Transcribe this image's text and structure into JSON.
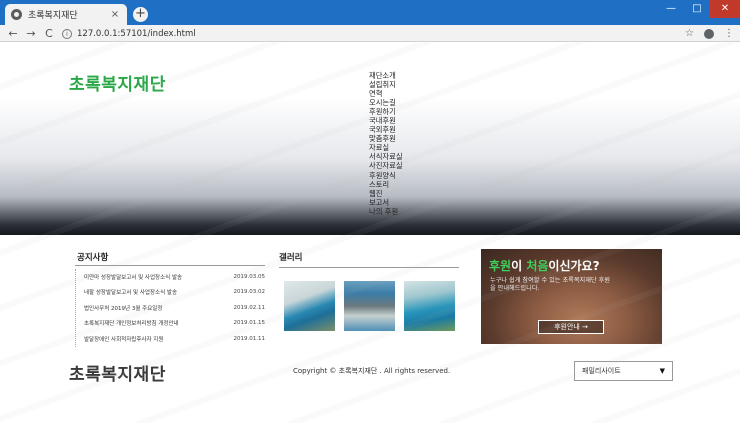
{
  "browser": {
    "tab_title": "초록복지재단",
    "tab_close": "×",
    "new_tab": "+",
    "url": "127.0.0.1:57101/index.html",
    "url_info": "i",
    "back": "←",
    "forward": "→",
    "reload": "C",
    "star": "☆",
    "menu": "⋮",
    "minimize": "—",
    "maximize": "□",
    "close": "✕"
  },
  "header": {
    "logo": "초록복지재단",
    "menu": [
      "재단소개",
      "설립취지",
      "연혁",
      "오시는길",
      "후원하기",
      "국내후원",
      "국외후원",
      "맞춤후원",
      "자료실",
      "서식자료실",
      "사진자료실",
      "후원양식",
      "스토리",
      "웹진",
      "보고서",
      "나의 후원"
    ]
  },
  "notice": {
    "title": "공지사항",
    "items": [
      {
        "title": "미얀마 성장발달보고서 및 사업장소식 발송",
        "date": "2019.03.05"
      },
      {
        "title": "네팔 성장발달보고서 및 사업장소식 발송",
        "date": "2019.03.02"
      },
      {
        "title": "법인사무처 2019년 3월 주요일정",
        "date": "2019.02.11"
      },
      {
        "title": "초록복지재단 개인정보처리방침 개정안내",
        "date": "2019.01.15"
      },
      {
        "title": "발달장애인 사회적자립후사자 지원",
        "date": "2019.01.11"
      }
    ]
  },
  "gallery": {
    "title": "갤러리"
  },
  "banner": {
    "headline_a": "후원",
    "headline_b": "이 ",
    "headline_c": "처음",
    "headline_d": "이신가요?",
    "sub": "누구나 쉽게 참여할 수 있는 초록복지재단 후원을 안내해드립니다.",
    "button": "후원안내 →"
  },
  "footer": {
    "logo": "초록복지재단",
    "copyright": "Copyright © 초록복지재단 . All rights reserved.",
    "family_site": "패밀리사이트",
    "caret": "▼"
  }
}
